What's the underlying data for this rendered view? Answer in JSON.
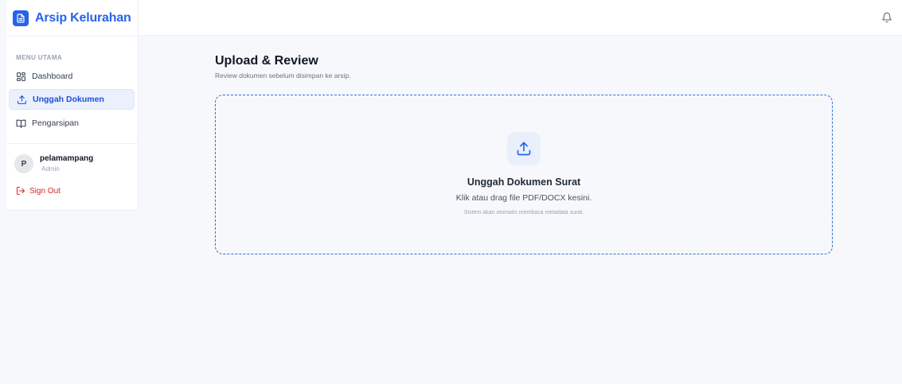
{
  "app": {
    "title": "Arsip Kelurahan",
    "brand_color": "#2563eb"
  },
  "sidebar": {
    "section_label": "MENU UTAMA",
    "items": [
      {
        "label": "Dashboard",
        "icon": "dashboard-grid-icon",
        "active": false
      },
      {
        "label": "Unggah Dokumen",
        "icon": "upload-icon",
        "active": true
      },
      {
        "label": "Pengarsipan",
        "icon": "book-open-icon",
        "active": false
      }
    ],
    "user": {
      "initial": "P",
      "name": "pelamampang",
      "role": "Admin"
    },
    "signout_label": "Sign Out",
    "signout_color": "#dc2626"
  },
  "topbar": {
    "notification_icon": "bell-icon"
  },
  "main": {
    "title": "Upload & Review",
    "subtitle": "Review dokumen sebelum disimpan ke arsip.",
    "dropzone": {
      "icon": "upload-icon",
      "title": "Unggah Dokumen Surat",
      "subtitle": "Klik atau drag file PDF/DOCX kesini.",
      "hint": "Sistem akan otomatis membaca metadata surat.",
      "border_color": "#2f6fd6"
    }
  }
}
